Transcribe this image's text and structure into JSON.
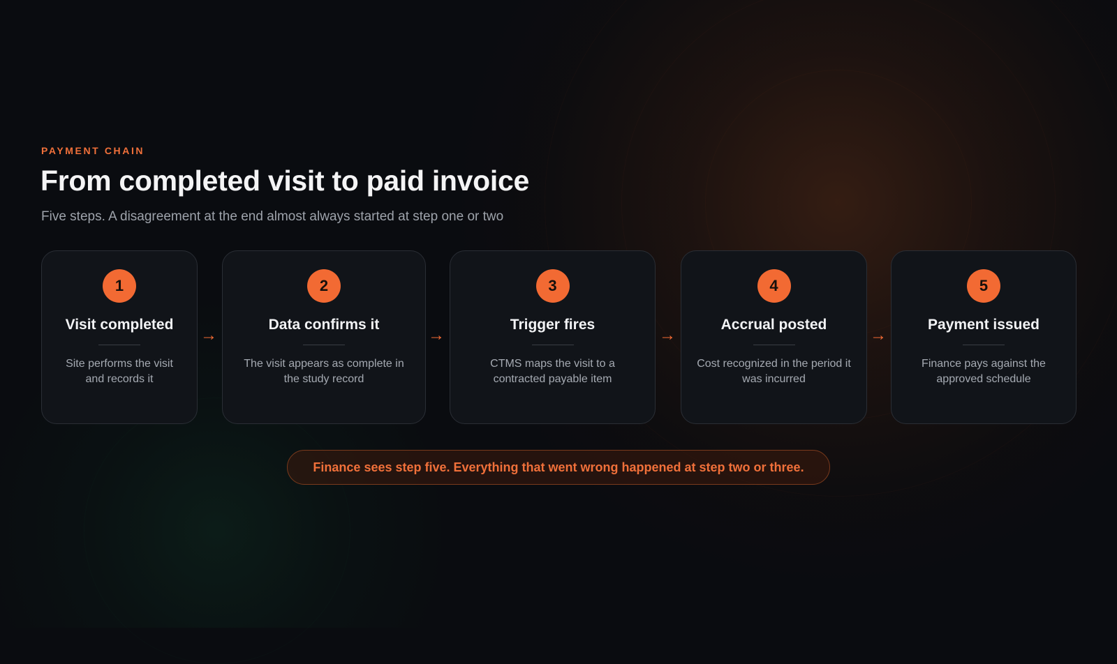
{
  "header": {
    "eyebrow": "PAYMENT CHAIN",
    "title": "From completed visit to paid invoice",
    "subtitle": "Five steps. A disagreement at the end almost always started at step one or two"
  },
  "steps": [
    {
      "number": "1",
      "title": "Visit completed",
      "description": "Site performs the visit and records it"
    },
    {
      "number": "2",
      "title": "Data confirms it",
      "description": "The visit appears as complete in the study record"
    },
    {
      "number": "3",
      "title": "Trigger fires",
      "description": "CTMS maps the visit to a contracted payable item"
    },
    {
      "number": "4",
      "title": "Accrual posted",
      "description": "Cost recognized in the period it was incurred"
    },
    {
      "number": "5",
      "title": "Payment issued",
      "description": "Finance pays against the approved schedule"
    }
  ],
  "arrow_icon": "arrow-right-icon",
  "note": "Finance sees step five. Everything that went wrong happened at step two or three.",
  "colors": {
    "accent": "#f26a33",
    "background": "#0a0c10",
    "card": "#111419"
  }
}
